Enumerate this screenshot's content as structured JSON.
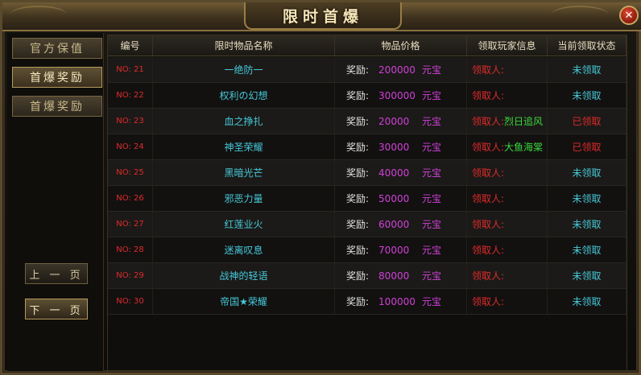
{
  "window": {
    "title": "限时首爆",
    "close_label": "✕"
  },
  "sidebar": {
    "tabs": [
      {
        "label": "官方保值"
      },
      {
        "label": "首爆奖励"
      },
      {
        "label": "首爆奖励"
      }
    ],
    "prev_label": "上 一 页",
    "next_label": "下 一 页"
  },
  "table": {
    "headers": [
      "编号",
      "限时物品名称",
      "物品价格",
      "领取玩家信息",
      "当前领取状态"
    ],
    "rows": [
      {
        "no": "NO: 21",
        "name": "一绝防一",
        "reward_label": "奖励:",
        "amount": "200000",
        "currency": "元宝",
        "info": "领取人:",
        "player": "",
        "status": "未领取",
        "claimed": false
      },
      {
        "no": "NO: 22",
        "name": "权利の幻想",
        "reward_label": "奖励:",
        "amount": "300000",
        "currency": "元宝",
        "info": "领取人:",
        "player": "",
        "status": "未领取",
        "claimed": false
      },
      {
        "no": "NO: 23",
        "name": "血之挣扎",
        "reward_label": "奖励:",
        "amount": "20000",
        "currency": "元宝",
        "info": "领取人:",
        "player": "烈日追风",
        "status": "已领取",
        "claimed": true
      },
      {
        "no": "NO: 24",
        "name": "神圣荣耀",
        "reward_label": "奖励:",
        "amount": "30000",
        "currency": "元宝",
        "info": "领取人:",
        "player": "大鱼海棠",
        "status": "已领取",
        "claimed": true
      },
      {
        "no": "NO: 25",
        "name": "黑暗光芒",
        "reward_label": "奖励:",
        "amount": "40000",
        "currency": "元宝",
        "info": "领取人:",
        "player": "",
        "status": "未领取",
        "claimed": false
      },
      {
        "no": "NO: 26",
        "name": "邪恶力量",
        "reward_label": "奖励:",
        "amount": "50000",
        "currency": "元宝",
        "info": "领取人:",
        "player": "",
        "status": "未领取",
        "claimed": false
      },
      {
        "no": "NO: 27",
        "name": "红莲业火",
        "reward_label": "奖励:",
        "amount": "60000",
        "currency": "元宝",
        "info": "领取人:",
        "player": "",
        "status": "未领取",
        "claimed": false
      },
      {
        "no": "NO: 28",
        "name": "迷离叹息",
        "reward_label": "奖励:",
        "amount": "70000",
        "currency": "元宝",
        "info": "领取人:",
        "player": "",
        "status": "未领取",
        "claimed": false
      },
      {
        "no": "NO: 29",
        "name": "战神的轻语",
        "reward_label": "奖励:",
        "amount": "80000",
        "currency": "元宝",
        "info": "领取人:",
        "player": "",
        "status": "未领取",
        "claimed": false
      },
      {
        "no": "NO: 30",
        "name": "帝国★荣耀",
        "reward_label": "奖励:",
        "amount": "100000",
        "currency": "元宝",
        "info": "领取人:",
        "player": "",
        "status": "未领取",
        "claimed": false
      }
    ]
  },
  "colors": {
    "item_name": "#46c8d8",
    "amount": "#d040d8",
    "number": "#e02a2a",
    "player": "#3cd83c",
    "unclaimed": "#46c8d8",
    "claimed": "#e02a2a"
  }
}
